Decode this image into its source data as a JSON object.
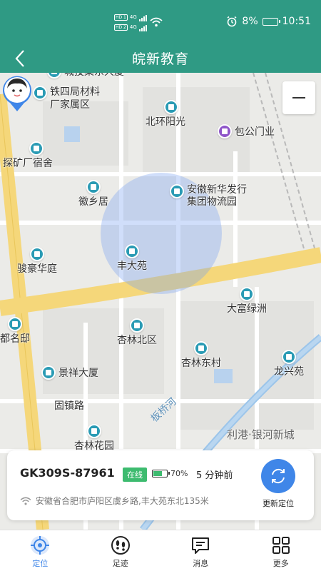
{
  "status_bar": {
    "sim1": "HD 1",
    "sim2": "HD 2",
    "network1": "4G",
    "network2": "4G",
    "battery": "8%",
    "time": "10:51"
  },
  "header": {
    "title": "皖新教育"
  },
  "map": {
    "pois": [
      {
        "name": "城投集东大厦",
        "icon": "building-icon"
      },
      {
        "name": "铁四局材料厂家属区",
        "icon": "building-icon"
      },
      {
        "name": "北环阳光",
        "icon": "building-icon"
      },
      {
        "name": "包公门业",
        "icon": "shop-icon"
      },
      {
        "name": "探矿厂宿舍",
        "icon": "building-icon"
      },
      {
        "name": "徽乡居",
        "icon": "building-icon"
      },
      {
        "name": "安徽新华发行集团物流园",
        "icon": "logistics-icon"
      },
      {
        "name": "骏豪华庭",
        "icon": "building-icon"
      },
      {
        "name": "丰大苑",
        "icon": "building-icon"
      },
      {
        "name": "大富绿洲",
        "icon": "building-icon"
      },
      {
        "name": "都名邸",
        "icon": "building-icon"
      },
      {
        "name": "杏林北区",
        "icon": "building-icon"
      },
      {
        "name": "杏林东村",
        "icon": "building-icon"
      },
      {
        "name": "景祥大厦",
        "icon": "building-icon"
      },
      {
        "name": "龙兴苑",
        "icon": "building-icon"
      },
      {
        "name": "固镇路",
        "icon": "road-icon"
      },
      {
        "name": "杏林花园",
        "icon": "building-icon"
      }
    ],
    "road_label": "板桥河",
    "district_label": "利港·银河新城",
    "zoom_out_label": "−"
  },
  "device": {
    "name": "GK309S-87961",
    "status": "在线",
    "battery_pct": "70%",
    "battery_level": 0.7,
    "time_ago": "5 分钟前",
    "address": "安徽省合肥市庐阳区虞乡路,丰大苑东北135米",
    "refresh_label": "更新定位"
  },
  "nav": [
    {
      "label": "定位",
      "icon": "location-icon",
      "active": true
    },
    {
      "label": "足迹",
      "icon": "footprint-icon",
      "active": false
    },
    {
      "label": "消息",
      "icon": "message-icon",
      "active": false
    },
    {
      "label": "更多",
      "icon": "grid-icon",
      "active": false
    }
  ],
  "colors": {
    "header": "#2f9a84",
    "accent": "#3f86e8",
    "online": "#3dbb6f"
  }
}
